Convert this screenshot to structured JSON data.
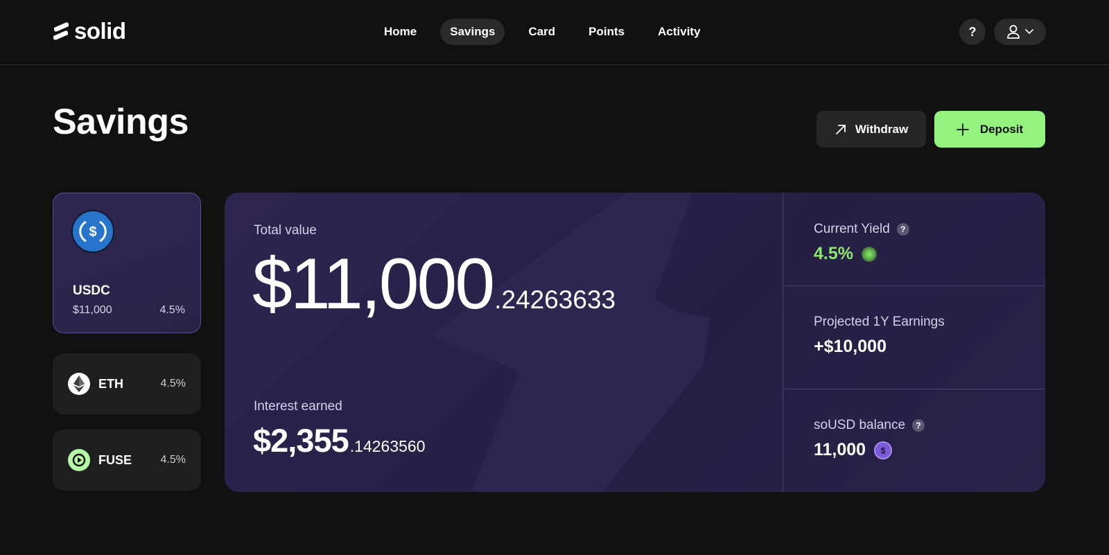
{
  "header": {
    "logo_text": "solid",
    "nav": [
      {
        "label": "Home",
        "active": false
      },
      {
        "label": "Savings",
        "active": true
      },
      {
        "label": "Card",
        "active": false
      },
      {
        "label": "Points",
        "active": false
      },
      {
        "label": "Activity",
        "active": false
      }
    ],
    "help_label": "?"
  },
  "page": {
    "title": "Savings",
    "withdraw_label": "Withdraw",
    "deposit_label": "Deposit"
  },
  "assets": [
    {
      "name": "USDC",
      "value": "$11,000",
      "rate": "4.5%",
      "selected": true,
      "icon": "usdc-icon"
    },
    {
      "name": "ETH",
      "rate": "4.5%",
      "selected": false,
      "icon": "eth-icon"
    },
    {
      "name": "FUSE",
      "rate": "4.5%",
      "selected": false,
      "icon": "fuse-icon"
    }
  ],
  "summary": {
    "total_label": "Total value",
    "total_int": "$11,000",
    "total_dec": ".24263633",
    "interest_label": "Interest earned",
    "interest_int": "$2,355",
    "interest_dec": ".14263560"
  },
  "stats": {
    "yield_label": "Current Yield",
    "yield_value": "4.5%",
    "projected_label": "Projected 1Y Earnings",
    "projected_value": "+$10,000",
    "balance_label": "soUSD balance",
    "balance_value": "11,000",
    "qmark": "?"
  },
  "colors": {
    "accent_green": "#94f27f",
    "yield_green": "#8ee66f",
    "panel_purple": "#2e2550",
    "usdc_blue": "#2775ca"
  }
}
